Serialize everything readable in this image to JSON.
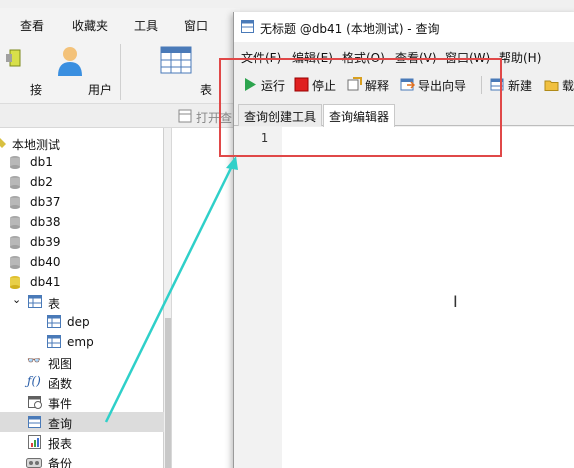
{
  "main_menu": [
    "查看",
    "收藏夹",
    "工具",
    "窗口"
  ],
  "main_toolbar": [
    {
      "label": "接",
      "icon": "connection-icon"
    },
    {
      "label": "用户",
      "icon": "user-icon"
    },
    {
      "label": "表",
      "icon": "table-icon"
    }
  ],
  "subbar": {
    "open_label": "打开查"
  },
  "nav": {
    "root": "本地测试",
    "databases": [
      "db1",
      "db2",
      "db37",
      "db38",
      "db39",
      "db40",
      "db41"
    ],
    "tables_group": "表",
    "tables": [
      "dep",
      "emp"
    ],
    "objects": [
      "视图",
      "函数",
      "事件",
      "查询",
      "报表",
      "备份"
    ],
    "selected": "查询"
  },
  "query_window": {
    "title": "无标题 @db41 (本地测试) - 查询",
    "menu": [
      "文件(F)",
      "编辑(E)",
      "格式(O)",
      "查看(V)",
      "窗口(W)",
      "帮助(H)"
    ],
    "toolbar": {
      "run": "运行",
      "stop": "停止",
      "explain": "解释",
      "export_wizard": "导出向导",
      "new": "新建",
      "partial": "载"
    },
    "tabs": [
      "查询创建工具",
      "查询编辑器"
    ],
    "active_tab": "查询编辑器",
    "line_number": "1"
  },
  "colors": {
    "highlight_box": "#e04848",
    "arrow": "#2fd0c9",
    "run_green": "#2da44e",
    "stop_red": "#e02020"
  }
}
